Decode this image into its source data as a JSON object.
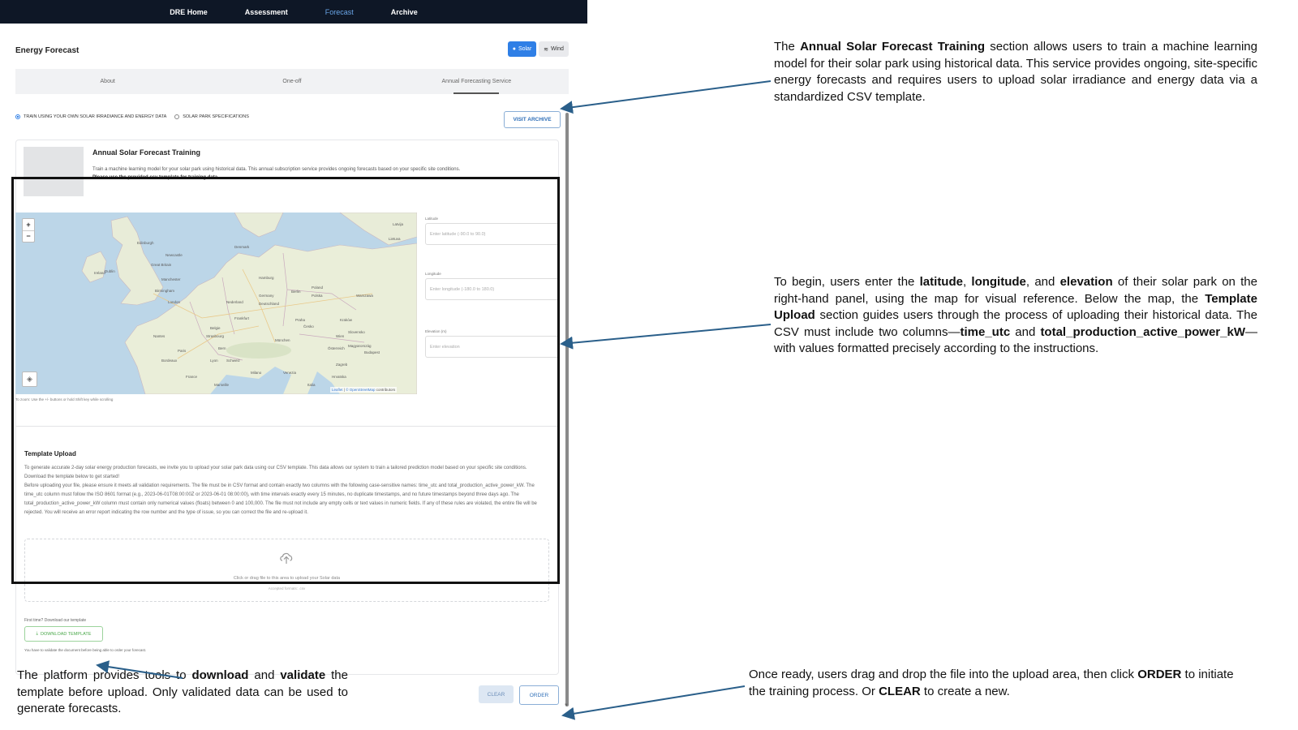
{
  "nav": {
    "items": [
      "DRE Home",
      "Assessment",
      "Forecast",
      "Archive"
    ],
    "active": "Forecast"
  },
  "app": {
    "title": "Energy Forecast",
    "toggle_solar": "Solar",
    "toggle_wind": "Wind"
  },
  "tabs": [
    "About",
    "One-off",
    "Annual Forecasting Service"
  ],
  "radio": {
    "option1": "TRAIN USING YOUR OWN SOLAR IRRADIANCE AND ENERGY DATA",
    "option2": "SOLAR PARK SPECIFICATIONS"
  },
  "visit_archive": "VISIT ARCHIVE",
  "section": {
    "title": "Annual Solar Forecast Training",
    "desc": "Train a machine learning model for your solar park using historical data. This annual subscription service provides ongoing forecasts based on your specific site conditions.",
    "desc_bold": "Please use the provided csv template for training data."
  },
  "map": {
    "zoom_in": "+",
    "zoom_out": "−",
    "attrib_leaflet": "Leaflet",
    "attrib_osm": "© OpenStreetMap",
    "attrib_rest": "contributors",
    "hint": "To zoom: Use the +/- buttons or hold Shift key while scrolling",
    "labels": [
      "Ireland",
      "Great Britain",
      "London",
      "Paris",
      "France",
      "Germany",
      "Deutschland",
      "Poland",
      "Polska",
      "Denmark",
      "Belgie",
      "Nederland",
      "Česko",
      "Österreich",
      "Slovensko",
      "Magyarország",
      "Schweiz",
      "Italia",
      "Hrvatska",
      "Lietuva",
      "Latvija",
      "Edinburgh",
      "Newcastle",
      "Birmingham",
      "Dublin",
      "Manchester",
      "Hamburg",
      "Berlin",
      "Praha",
      "Wien",
      "München",
      "Lyon",
      "Bordeaux",
      "Nantes",
      "Marseille",
      "Milano",
      "Frankfurt",
      "Warszawa",
      "Kraków",
      "Budapest",
      "Zagreb",
      "Venezia",
      "Bern",
      "Strasbourg"
    ]
  },
  "fields": [
    {
      "label": "Latitude",
      "placeholder": "Enter latitude (-90.0 to 90.0)"
    },
    {
      "label": "Longitude",
      "placeholder": "Enter longitude (-180.0 to 180.0)"
    },
    {
      "label": "Elevation (m)",
      "placeholder": "Enter elevation"
    }
  ],
  "template": {
    "title": "Template Upload",
    "p1": "To generate accurate 2-day solar energy production forecasts, we invite you to upload your solar park data using our CSV template. This data allows our system to train a tailored prediction model based on your specific site conditions. Download the template below to get started!",
    "p2": "Before uploading your file, please ensure it meets all validation requirements. The file must be in CSV format and contain exactly two columns with the following case-sensitive names: time_utc and total_production_active_power_kW. The time_utc column must follow the ISO 8601 format (e.g., 2023-06-01T08:00:00Z or 2023-06-01 08:00:00), with time intervals exactly every 15 minutes, no duplicate timestamps, and no future timestamps beyond three days ago. The total_production_active_power_kW column must contain only numerical values (floats) between 0 and 100,000. The file must not include any empty cells or text values in numeric fields. If any of these rules are violated, the entire file will be rejected. You will receive an error report indicating the row number and the type of issue, so you can correct the file and re-upload it.",
    "drop_text": "Click or drag file to this area to upload your Solar data",
    "drop_sub": "Accepted formats: .csv",
    "first_time": "First time? Download our template",
    "download": "DOWNLOAD TEMPLATE",
    "validate_note": "You have to validate the document before being able to order your forecast."
  },
  "buttons": {
    "clear": "CLEAR",
    "order": "ORDER"
  },
  "annotations": {
    "n1": {
      "pre": "The ",
      "b1": "Annual Solar Forecast Training",
      "post": " section allows users to train a machine learning model for their solar park using historical data. This service provides ongoing, site-specific energy forecasts and requires users to upload solar irradiance and energy data via a standardized CSV template."
    },
    "n2": {
      "t1": "To begin, users enter the ",
      "b1": "latitude",
      "t2": ", ",
      "b2": "longitude",
      "t3": ", and ",
      "b3": "elevation",
      "t4": " of their solar park on the right-hand panel, using the map for visual reference. Below the map, the ",
      "b4": "Template Upload",
      "t5": " section guides users through the process of uploading their historical data. The CSV must include two columns—",
      "b5": "time_utc",
      "t6": " and ",
      "b6": "total_production_active_power_kW",
      "t7": "—with values formatted precisely according to the instructions."
    },
    "n3": {
      "t1": "Once ready, users drag and drop the file into the upload area, then click ",
      "b1": "ORDER",
      "t2": " to initiate the training process. Or ",
      "b2": "CLEAR",
      "t3": " to create a new."
    },
    "n4": {
      "t1": "The platform provides tools to ",
      "b1": "download",
      "t2": " and ",
      "b2": "validate",
      "t3": " the template before upload. Only validated data can be used to generate forecasts."
    }
  },
  "colors": {
    "nav_bg": "#0e1726",
    "accent": "#2f7fe6",
    "arrow": "#2a5f8a",
    "success": "#4aa84a"
  }
}
